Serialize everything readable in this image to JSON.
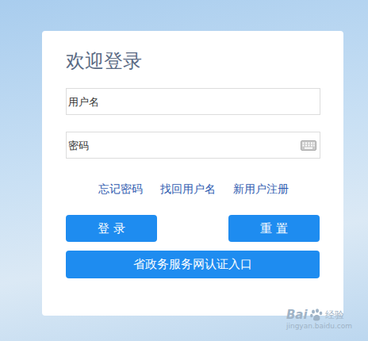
{
  "title": "欢迎登录",
  "fields": [
    {
      "placeholder": "用户名",
      "kind": "text"
    },
    {
      "placeholder": "密码",
      "kind": "password"
    }
  ],
  "links": [
    "忘记密码",
    "找回用户名",
    "新用户注册"
  ],
  "buttons": [
    "登 录",
    "重 置"
  ],
  "wide_button": "省政务服务网认证入口",
  "watermark": {
    "brand": "Bai",
    "product": "经验",
    "url": "jingyan.baidu.com"
  }
}
